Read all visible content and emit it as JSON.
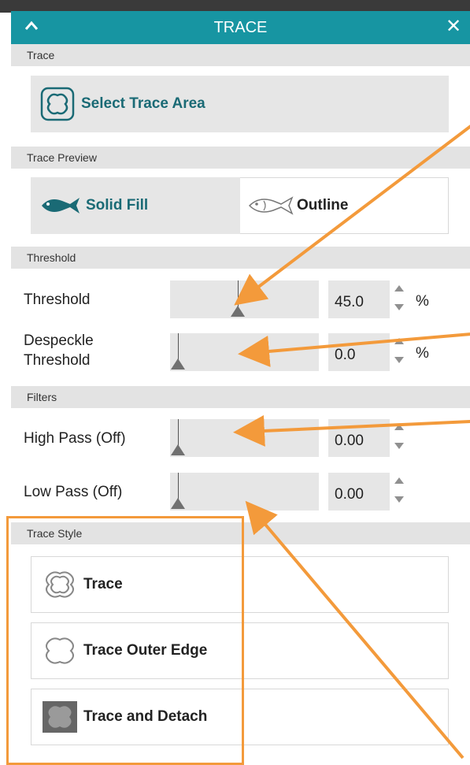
{
  "panel": {
    "title": "TRACE",
    "close_glyph": "✕",
    "accent_color": "#1795a2"
  },
  "sections": {
    "trace": "Trace",
    "trace_preview": "Trace Preview",
    "threshold": "Threshold",
    "filters": "Filters",
    "trace_style": "Trace Style"
  },
  "buttons": {
    "select_trace_area": "Select Trace Area",
    "solid_fill": "Solid Fill",
    "outline": "Outline"
  },
  "sliders": {
    "threshold": {
      "label": "Threshold",
      "value": "45.0",
      "unit": "%",
      "fraction": 0.45
    },
    "despeckle_line1": "Despeckle",
    "despeckle_line2": "Threshold",
    "despeckle": {
      "value": "0.0",
      "unit": "%",
      "fraction": 0.0
    },
    "high_pass": {
      "label": "High Pass (Off)",
      "value": "0.00",
      "fraction": 0.0
    },
    "low_pass": {
      "label": "Low Pass (Off)",
      "value": "0.00",
      "fraction": 0.0
    }
  },
  "trace_styles": {
    "trace": "Trace",
    "trace_outer_edge": "Trace Outer Edge",
    "trace_and_detach": "Trace and Detach"
  },
  "icons": [
    "chevron-up-icon",
    "close-icon",
    "trace-area-icon",
    "fish-solid-icon",
    "fish-outline-icon",
    "trace-style-icon",
    "trace-outer-edge-icon",
    "trace-detach-icon"
  ],
  "annotation_color": "#f39a3b"
}
